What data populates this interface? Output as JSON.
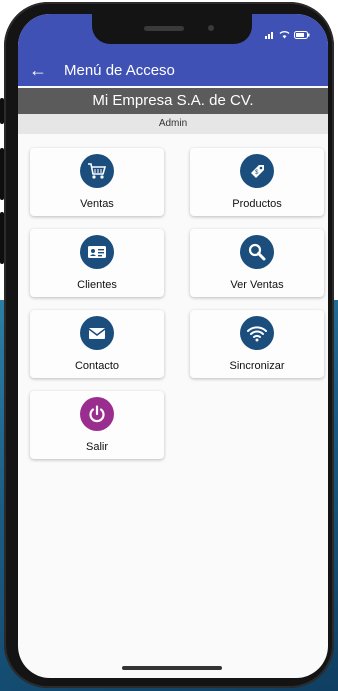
{
  "app": {
    "title": "Menú de Acceso",
    "back_label": "←"
  },
  "header": {
    "company": "Mi Empresa S.A. de CV.",
    "user": "Admin"
  },
  "menu": [
    {
      "label": "Ventas",
      "icon": "shopping-cart-icon"
    },
    {
      "label": "Productos",
      "icon": "price-tag-icon"
    },
    {
      "label": "Clientes",
      "icon": "contact-card-icon"
    },
    {
      "label": "Ver Ventas",
      "icon": "search-icon"
    },
    {
      "label": "Contacto",
      "icon": "mail-icon"
    },
    {
      "label": "Sincronizar",
      "icon": "wifi-icon"
    },
    {
      "label": "Salir",
      "icon": "power-icon"
    }
  ],
  "colors": {
    "primary": "#3f51b5",
    "icon_blue": "#1b4e7c",
    "icon_purple": "#9a2e8f",
    "company_bar": "#5b5b5b",
    "user_bar": "#e6e6e6"
  }
}
